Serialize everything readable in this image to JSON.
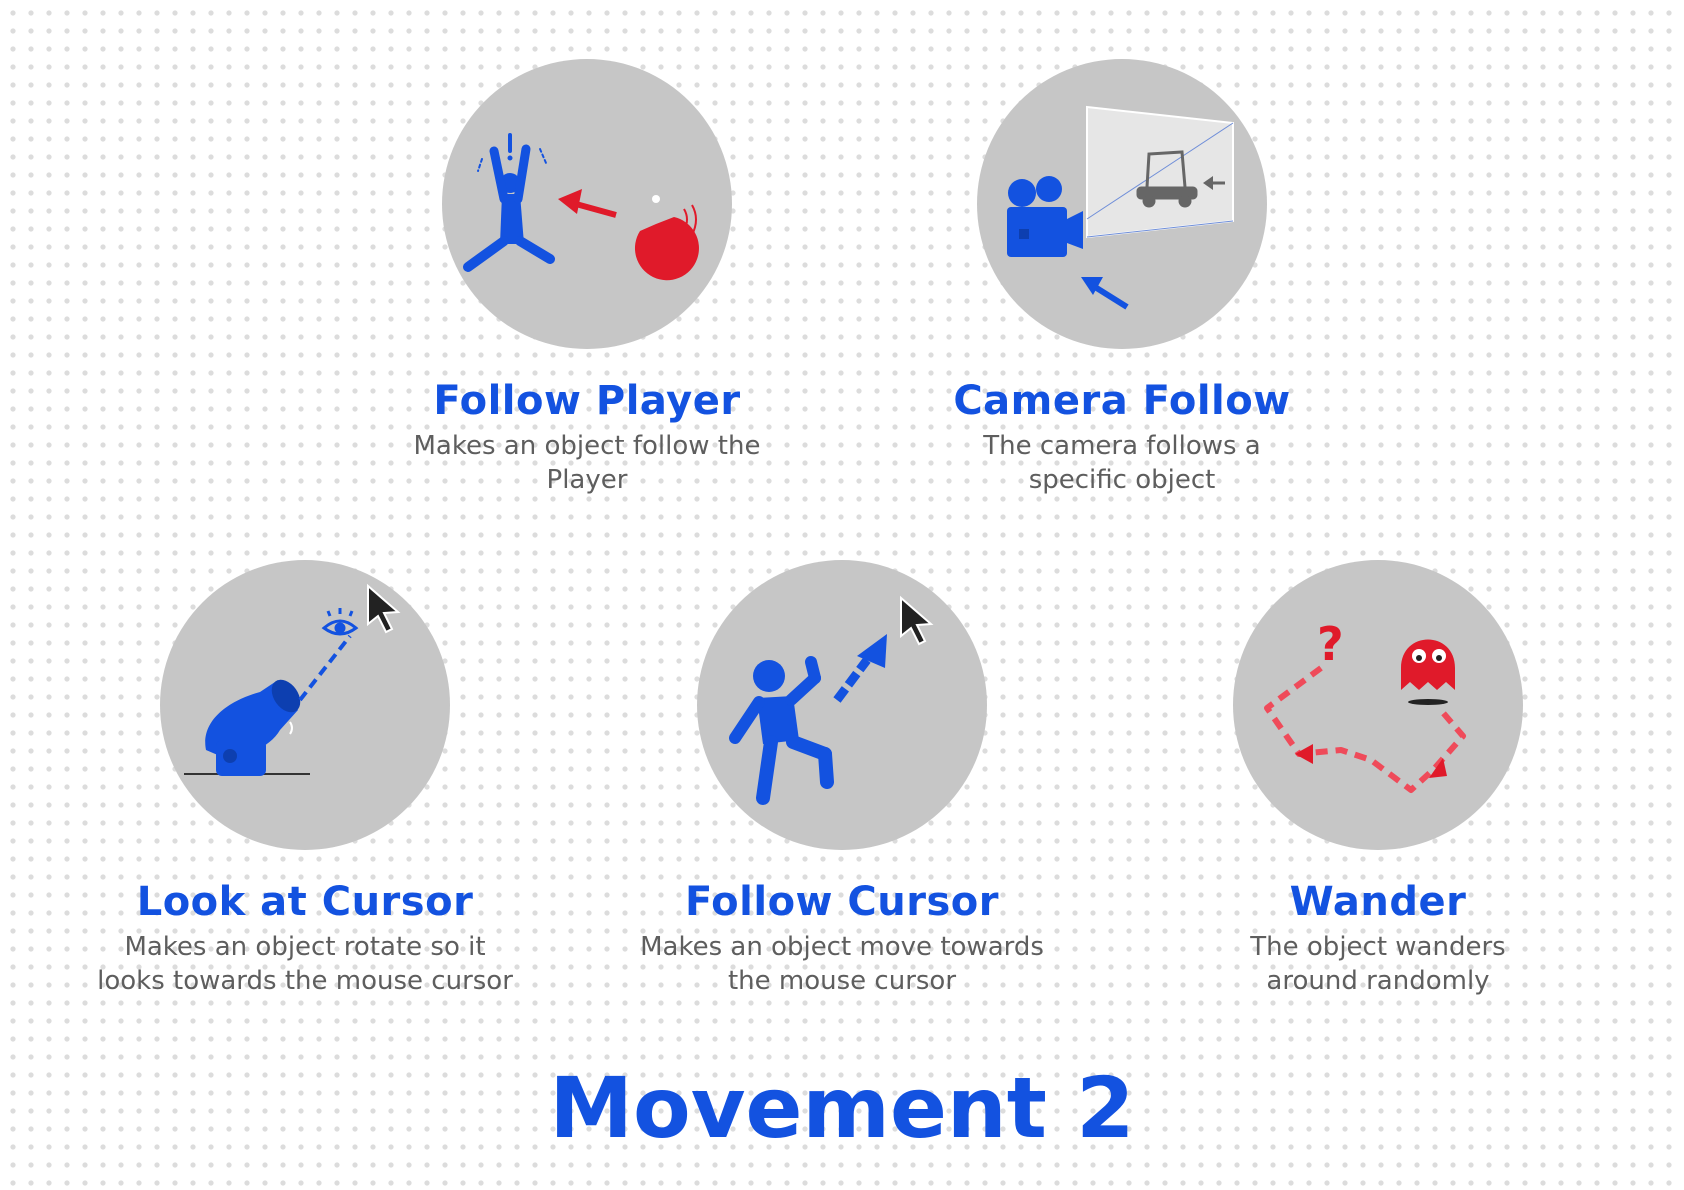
{
  "cards": [
    {
      "title": "Follow Player",
      "description": "Makes an object follow the Player",
      "icon": "fleeing-person-chased-by-chomper-icon"
    },
    {
      "title": "Camera Follow",
      "description": "The camera follows a specific object",
      "icon": "movie-camera-tracking-car-icon"
    },
    {
      "title": "Look at Cursor",
      "description": "Makes an object rotate so it looks towards the mouse cursor",
      "icon": "cannon-aiming-at-cursor-icon"
    },
    {
      "title": "Follow Cursor",
      "description": "Makes an object move towards the mouse cursor",
      "icon": "person-walking-to-cursor-icon"
    },
    {
      "title": "Wander",
      "description": "The object wanders around randomly",
      "icon": "ghost-random-path-icon"
    }
  ],
  "main_title": "Movement 2",
  "colors": {
    "accent_blue": "#1352e0",
    "accent_red": "#e01a2a",
    "circle_gray": "#c6c6c6",
    "text_gray": "#5e5e5e"
  }
}
